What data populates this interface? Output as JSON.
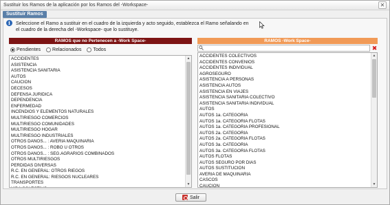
{
  "window": {
    "title": "Sustituir los Ramos de la aplicación por los Ramos del -Workspace-",
    "close_glyph": "✕"
  },
  "group": {
    "legend": "Sustituir Ramos",
    "info_text": "Seleccione el Ramo a sustituir en el cuadro de la izquierda y acto seguido, establezca el Ramo señalando en el cuadro de la derecha del -Workspace- que lo sustituye."
  },
  "left_panel": {
    "header": "RAMOS que no Pertenecen a -Work Space-",
    "filters": [
      {
        "label": "Pendientes",
        "selected": true
      },
      {
        "label": "Relacionados",
        "selected": false
      },
      {
        "label": "Todos",
        "selected": false
      }
    ],
    "items": [
      "ACCIDENTES",
      "ASISTENCIA",
      "ASISTENCIA SANITARIA",
      "AUTOS",
      "CAUCION",
      "DECESOS",
      "DEFENSA JURIDICA",
      "DEPENDENCIA",
      "ENFERMEDAD",
      "INCENDIOS Y ELEMENTOS NATURALES",
      "MULTIRIESGO COMERCIOS",
      "MULTIRIESGO COMUNIDADES",
      "MULTIRIESGO HOGAR",
      "MULTIRIESGO INDUSTRIALES",
      "OTROS DAÑOS... : AVERIA MAQUINARIA",
      "OTROS DAÑOS... : ROBO U OTROS",
      "OTROS DAÑOS... : SEG.AGRARIOS COMBINADOS",
      "OTROS MULTIRIESGOS",
      "PERDIDAS DIVERSAS",
      "R.C. EN GENERAL: OTROS RIEGOS",
      "R.C. EN GENERAL: RIESGOS NUCLEARES",
      "TRANSPORTES",
      "VIDA COLECTIVO"
    ]
  },
  "right_panel": {
    "header": "RAMOS -Work Space-",
    "search": {
      "value": "",
      "placeholder": ""
    },
    "clear_glyph": "✖",
    "items": [
      "ACCIDENTES COLECTIVOS",
      "ACCIDENTES CONVENIOS",
      "ACCIDENTES INDIVIDUAL",
      "AGROSEGURO",
      "ASISTENCIA A PERSONAS",
      "ASISTENCIA AUTOS",
      "ASISTENCIA EN VIAJES",
      "ASISTENCIA SANITARIA COLECTIVO",
      "ASISTENCIA SANITARIA INDIVIDUAL",
      "AUTOS",
      "AUTOS 1a. CATEGORIA",
      "AUTOS 1a. CATEGORIA FLOTAS",
      "AUTOS 1a. CATEGORIA PROFESIONAL",
      "AUTOS 2a. CATEGORIA",
      "AUTOS 2a. CATEGORIA FLOTAS",
      "AUTOS 3a. CATEGORIA",
      "AUTOS 3a. CATEGORIA FLOTAS",
      "AUTOS FLOTAS",
      "AUTOS SEGURO POR DIAS",
      "AUTOS SUSTITUCION",
      "AVERIA DE MAQUINARIA",
      "CASCOS",
      "CAUCION"
    ]
  },
  "footer": {
    "exit_label": "Salir"
  },
  "colors": {
    "left_header_bg": "#7d1414",
    "right_header_bg": "#f19a57",
    "legend_bg": "#5a7fa8",
    "info_icon": "#2b66b5",
    "clear_icon": "#d51d1d"
  }
}
